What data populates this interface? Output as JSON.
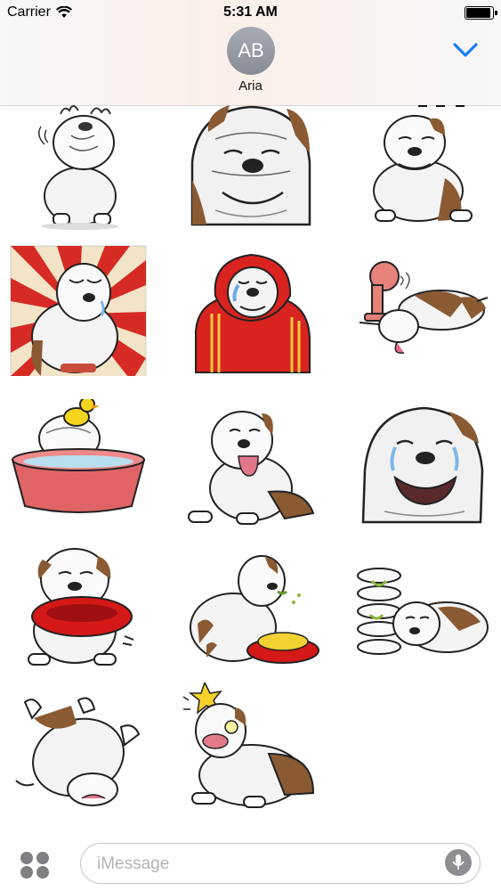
{
  "status_bar": {
    "carrier": "Carrier",
    "time": "5:31 AM",
    "wifi_icon": "wifi-icon",
    "battery_icon": "battery-icon",
    "battery_level": 0.86
  },
  "conversation": {
    "avatar_initials": "AB",
    "contact_name": "Aria",
    "collapse_icon": "chevron-down-icon",
    "accent_color": "#1a7ef5"
  },
  "sticker_pack": {
    "stickers": [
      {
        "id": "bulldog-steaming"
      },
      {
        "id": "bulldog-closeup-grumpy"
      },
      {
        "id": "bulldog-sitting-annoyed"
      },
      {
        "id": "bulldog-crying-sunburst"
      },
      {
        "id": "bulldog-red-hoodie-crying"
      },
      {
        "id": "bulldog-lying-fan"
      },
      {
        "id": "bulldog-bath-duck"
      },
      {
        "id": "bulldog-tongue-out"
      },
      {
        "id": "bulldog-big-face-crying"
      },
      {
        "id": "bulldog-holding-bowl"
      },
      {
        "id": "bulldog-eating-food"
      },
      {
        "id": "bulldog-stacked-bowls"
      },
      {
        "id": "bulldog-on-back"
      },
      {
        "id": "bulldog-surprised-star"
      }
    ]
  },
  "compose": {
    "apps_icon": "app-drawer-icon",
    "placeholder": "iMessage",
    "mic_icon": "microphone-icon"
  }
}
